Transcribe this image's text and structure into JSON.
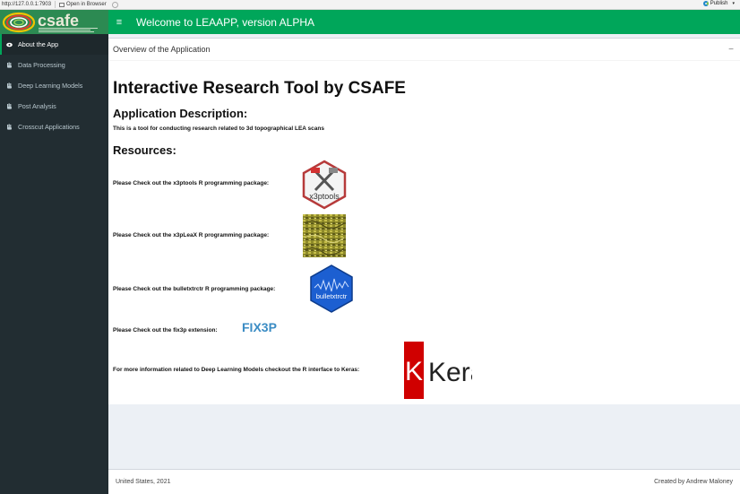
{
  "browser": {
    "url": "http://127.0.0.1:7903",
    "open_label": "Open in Browser",
    "publish_label": "Publish"
  },
  "logo": {
    "text": "csafe"
  },
  "navbar": {
    "title": "Welcome to LEAAPP, version ALPHA"
  },
  "sidebar": {
    "items": [
      {
        "label": "About the App",
        "icon": "eye-icon",
        "active": true
      },
      {
        "label": "Data Processing",
        "icon": "hand-icon"
      },
      {
        "label": "Deep Learning Models",
        "icon": "hand-icon"
      },
      {
        "label": "Post Analysis",
        "icon": "hand-icon"
      },
      {
        "label": "Crosscut Applications",
        "icon": "hand-icon"
      }
    ]
  },
  "box": {
    "title": "Overview of the Application",
    "collapse": "−"
  },
  "main": {
    "heading": "Interactive Research Tool by CSAFE",
    "desc_heading": "Application Description:",
    "description": "This is a tool for conducting research related to 3d topographical LEA scans",
    "resources_heading": "Resources:",
    "resources": [
      {
        "text": "Please Check out the x3ptools R programming package:",
        "image": "x3ptools-hex-logo"
      },
      {
        "text": "Please Check out the x3pLeaX R programming package:",
        "image": "x3pleax-texture"
      },
      {
        "text": "Please Check out the bulletxtrctr R programming package:",
        "image": "bulletxtrctr-hex-logo"
      },
      {
        "text": "Please Check out the fix3p extension:",
        "link": "FIX3P"
      },
      {
        "text": "For more information related to Deep Learning Models checkout the R interface to Keras:",
        "image": "keras-logo"
      }
    ],
    "x3ptools_label": "x3ptools",
    "bulletxtrctr_label": "bulletxtrctr",
    "keras_k": "K",
    "keras_label": "Keras"
  },
  "footer": {
    "left": "United States, 2021",
    "right": "Created by Andrew Maloney"
  },
  "colors": {
    "header": "#00a65a",
    "sidebar": "#222d32",
    "logo_bg": "#2c8a52",
    "fix3p": "#3b8cc4",
    "keras_red": "#d00000"
  }
}
